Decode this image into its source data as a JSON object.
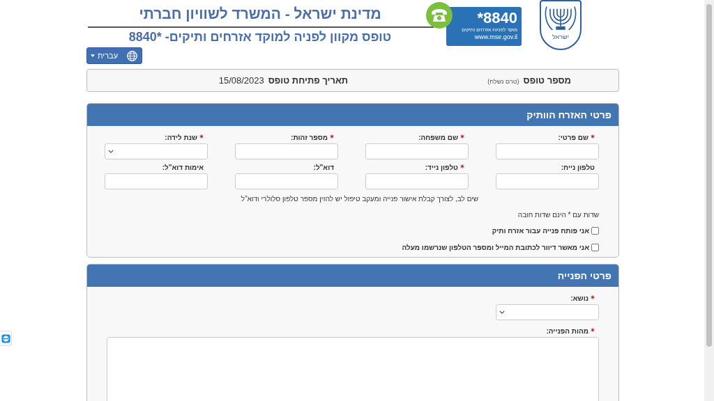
{
  "header": {
    "title": "מדינת ישראל - המשרד לשוויון חברתי",
    "subtitle": "טופס מקוון לפניה למוקד אזרחים ותיקים- *8840",
    "language_button": "עברית",
    "hotline_logo": {
      "number": "*8840",
      "caption": "מוקד לפניות אזרחים ותיקים",
      "url": "www.mse.gov.il"
    },
    "emblem_text": "ישראל"
  },
  "form_info": {
    "number_label": "מספר טופס",
    "number_note": "(טרם נשלח)",
    "date_label": "תאריך פתיחת טופס",
    "date_value": "15/08/2023"
  },
  "citizen_panel": {
    "title": "פרטי האזרח הוותיק",
    "fields": [
      {
        "label": "שם פרטי:",
        "required": true,
        "kind": "text"
      },
      {
        "label": "שם משפחה:",
        "required": true,
        "kind": "text"
      },
      {
        "label": "מספר זהות:",
        "required": true,
        "kind": "text"
      },
      {
        "label": "שנת לידה:",
        "required": true,
        "kind": "select"
      },
      {
        "label": "טלפון נייח:",
        "required": false,
        "kind": "text"
      },
      {
        "label": "טלפון נייד:",
        "required": true,
        "kind": "text"
      },
      {
        "label": "דוא\"ל:",
        "required": false,
        "kind": "text"
      },
      {
        "label": "אימות דוא\"ל:",
        "required": false,
        "kind": "text"
      }
    ],
    "notice": "שים לב, לצורך קבלת אישור פנייה ומעקב טיפול יש להזין מספר טלפון סלולרי ודוא\"ל",
    "required_note": "שדות עם * הינם שדות חובה",
    "checkboxes": [
      {
        "label": "אני פותח פנייה עבור אזרח ותיק",
        "checked": false
      },
      {
        "label": "אני מאשר דיוור לכתובת המייל ומספר הטלפון שנרשמו מעלה",
        "checked": false
      }
    ]
  },
  "request_panel": {
    "title": "פרטי הפנייה",
    "fields": [
      {
        "label": "נושא:",
        "required": true,
        "kind": "select"
      },
      {
        "label": "מהות הפנייה:",
        "required": true,
        "kind": "textarea"
      }
    ]
  }
}
